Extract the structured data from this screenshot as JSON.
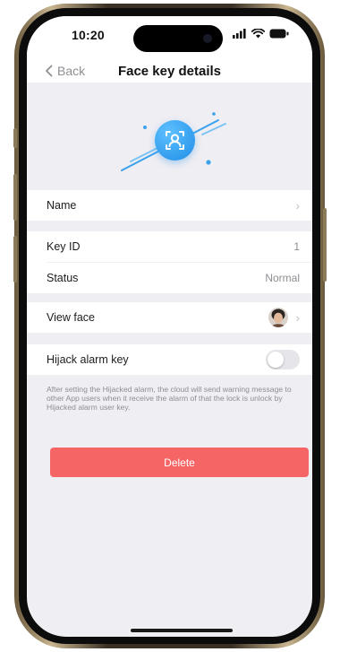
{
  "status_bar": {
    "time": "10:20"
  },
  "nav": {
    "back_label": "Back",
    "title": "Face key details"
  },
  "rows": {
    "name": {
      "label": "Name"
    },
    "key_id": {
      "label": "Key ID",
      "value": "1"
    },
    "status": {
      "label": "Status",
      "value": "Normal"
    },
    "view_face": {
      "label": "View face"
    },
    "hijack": {
      "label": "Hijack alarm key",
      "enabled": false
    }
  },
  "note": "After setting the Hijacked alarm, the cloud will send warning message to other App users when it receive the alarm of that the lock is unlock by Hijacked alarm user key.",
  "delete_label": "Delete",
  "colors": {
    "accent": "#1f8ee6",
    "danger": "#f66565",
    "background": "#efeef3"
  }
}
